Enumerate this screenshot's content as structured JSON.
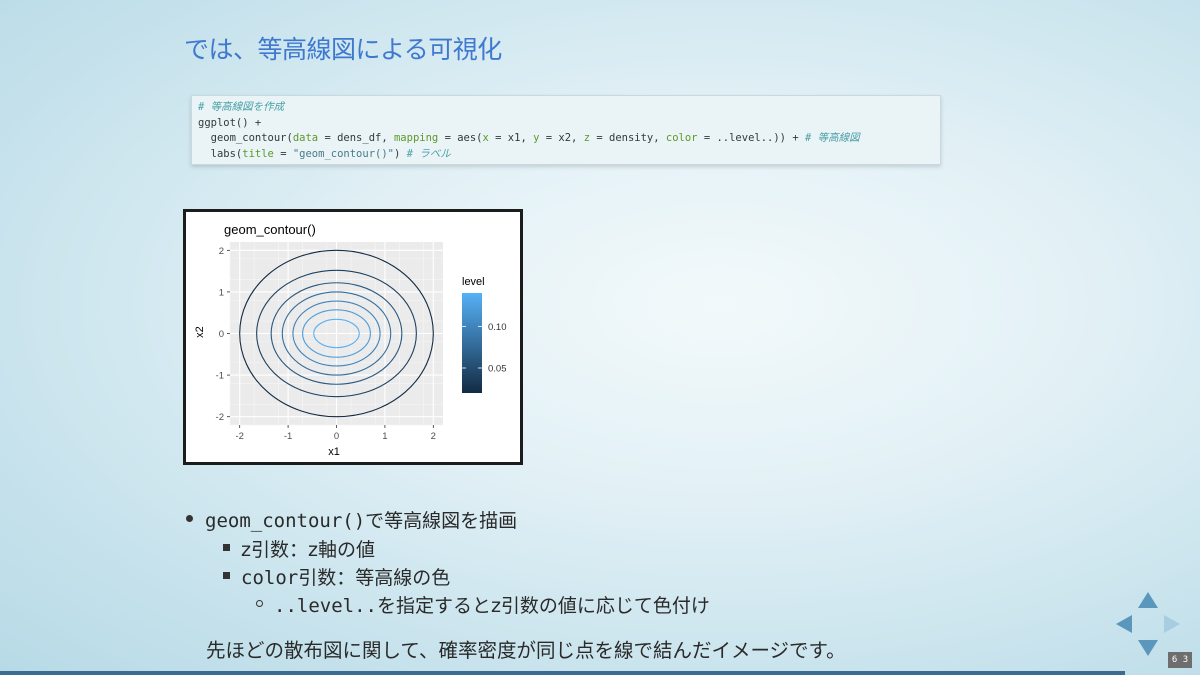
{
  "slide": {
    "title": "では、等高線図による可視化",
    "code_lines": [
      [
        {
          "t": "# 等高線図を作成",
          "c": "cm"
        }
      ],
      [
        {
          "t": "ggplot() +",
          "c": ""
        }
      ],
      [
        {
          "t": "  geom_contour(",
          "c": ""
        },
        {
          "t": "data",
          "c": "kw"
        },
        {
          "t": " = dens_df, ",
          "c": ""
        },
        {
          "t": "mapping",
          "c": "kw"
        },
        {
          "t": " = aes(",
          "c": ""
        },
        {
          "t": "x",
          "c": "kw"
        },
        {
          "t": " = x1, ",
          "c": ""
        },
        {
          "t": "y",
          "c": "kw"
        },
        {
          "t": " = x2, ",
          "c": ""
        },
        {
          "t": "z",
          "c": "kw"
        },
        {
          "t": " = density, ",
          "c": ""
        },
        {
          "t": "color",
          "c": "kw"
        },
        {
          "t": " = ..level..)) + ",
          "c": ""
        },
        {
          "t": "# 等高線図",
          "c": "cm"
        }
      ],
      [
        {
          "t": "  labs(",
          "c": ""
        },
        {
          "t": "title",
          "c": "kw"
        },
        {
          "t": " = ",
          "c": ""
        },
        {
          "t": "\"geom_contour()\"",
          "c": "st"
        },
        {
          "t": ") ",
          "c": ""
        },
        {
          "t": "# ラベル",
          "c": "cm"
        }
      ]
    ],
    "bullets": {
      "b1_code": "geom_contour()",
      "b1_text": "で等高線図を描画",
      "b2": "z引数：z軸の値",
      "b3_code": "color",
      "b3_text": "引数：等高線の色",
      "b4_code": "..level..",
      "b4_text": "を指定するとz引数の値に応じて色付け"
    },
    "summary": "先ほどの散布図に関して、確率密度が同じ点を線で結んだイメージです。",
    "page_counter": "6 3"
  },
  "colors": {
    "title": "#3f79cf",
    "level_low": "#132b43",
    "level_high": "#56b1f7",
    "panel_bg": "#ebebeb"
  },
  "chart_data": {
    "type": "contour",
    "title": "geom_contour()",
    "xlabel": "x1",
    "ylabel": "x2",
    "xlim": [
      -2.2,
      2.2
    ],
    "ylim": [
      -2.2,
      2.2
    ],
    "xticks": [
      -2,
      -1,
      0,
      1,
      2
    ],
    "yticks": [
      -2,
      -1,
      0,
      1,
      2
    ],
    "contours": [
      {
        "rx": 2.0,
        "ry": 2.0,
        "level": 0.02
      },
      {
        "rx": 1.65,
        "ry": 1.52,
        "level": 0.04
      },
      {
        "rx": 1.35,
        "ry": 1.22,
        "level": 0.06
      },
      {
        "rx": 1.12,
        "ry": 1.0,
        "level": 0.08
      },
      {
        "rx": 0.9,
        "ry": 0.78,
        "level": 0.1
      },
      {
        "rx": 0.7,
        "ry": 0.57,
        "level": 0.12
      },
      {
        "rx": 0.47,
        "ry": 0.34,
        "level": 0.14
      }
    ],
    "legend": {
      "title": "level",
      "position": "right",
      "range": [
        0.02,
        0.14
      ],
      "ticks": [
        0.05,
        0.1
      ],
      "tick_labels": [
        "0.05",
        "0.10"
      ]
    },
    "grid": true
  }
}
